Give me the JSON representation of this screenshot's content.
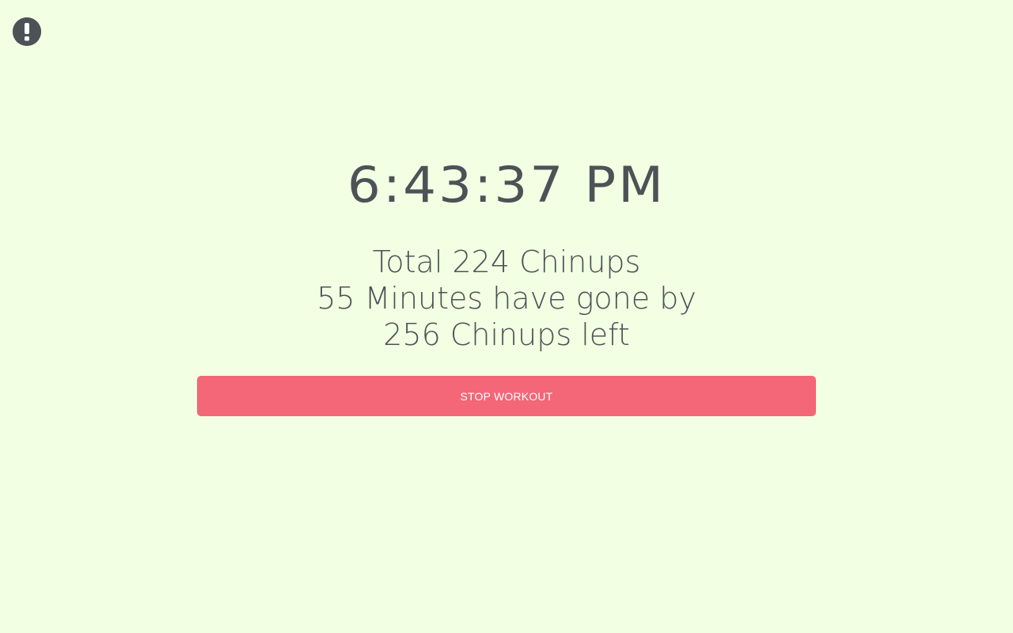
{
  "alert": {
    "icon": "exclamation-circle-icon"
  },
  "clock": {
    "time": "6:43:37 PM"
  },
  "stats": {
    "total": "Total 224 Chinups",
    "elapsed": "55 Minutes have gone by",
    "remaining": "256 Chinups left"
  },
  "actions": {
    "stop_label": "STOP WORKOUT"
  },
  "colors": {
    "background": "#f3ffe2",
    "text": "#4d5257",
    "stop_button": "#f36778"
  }
}
